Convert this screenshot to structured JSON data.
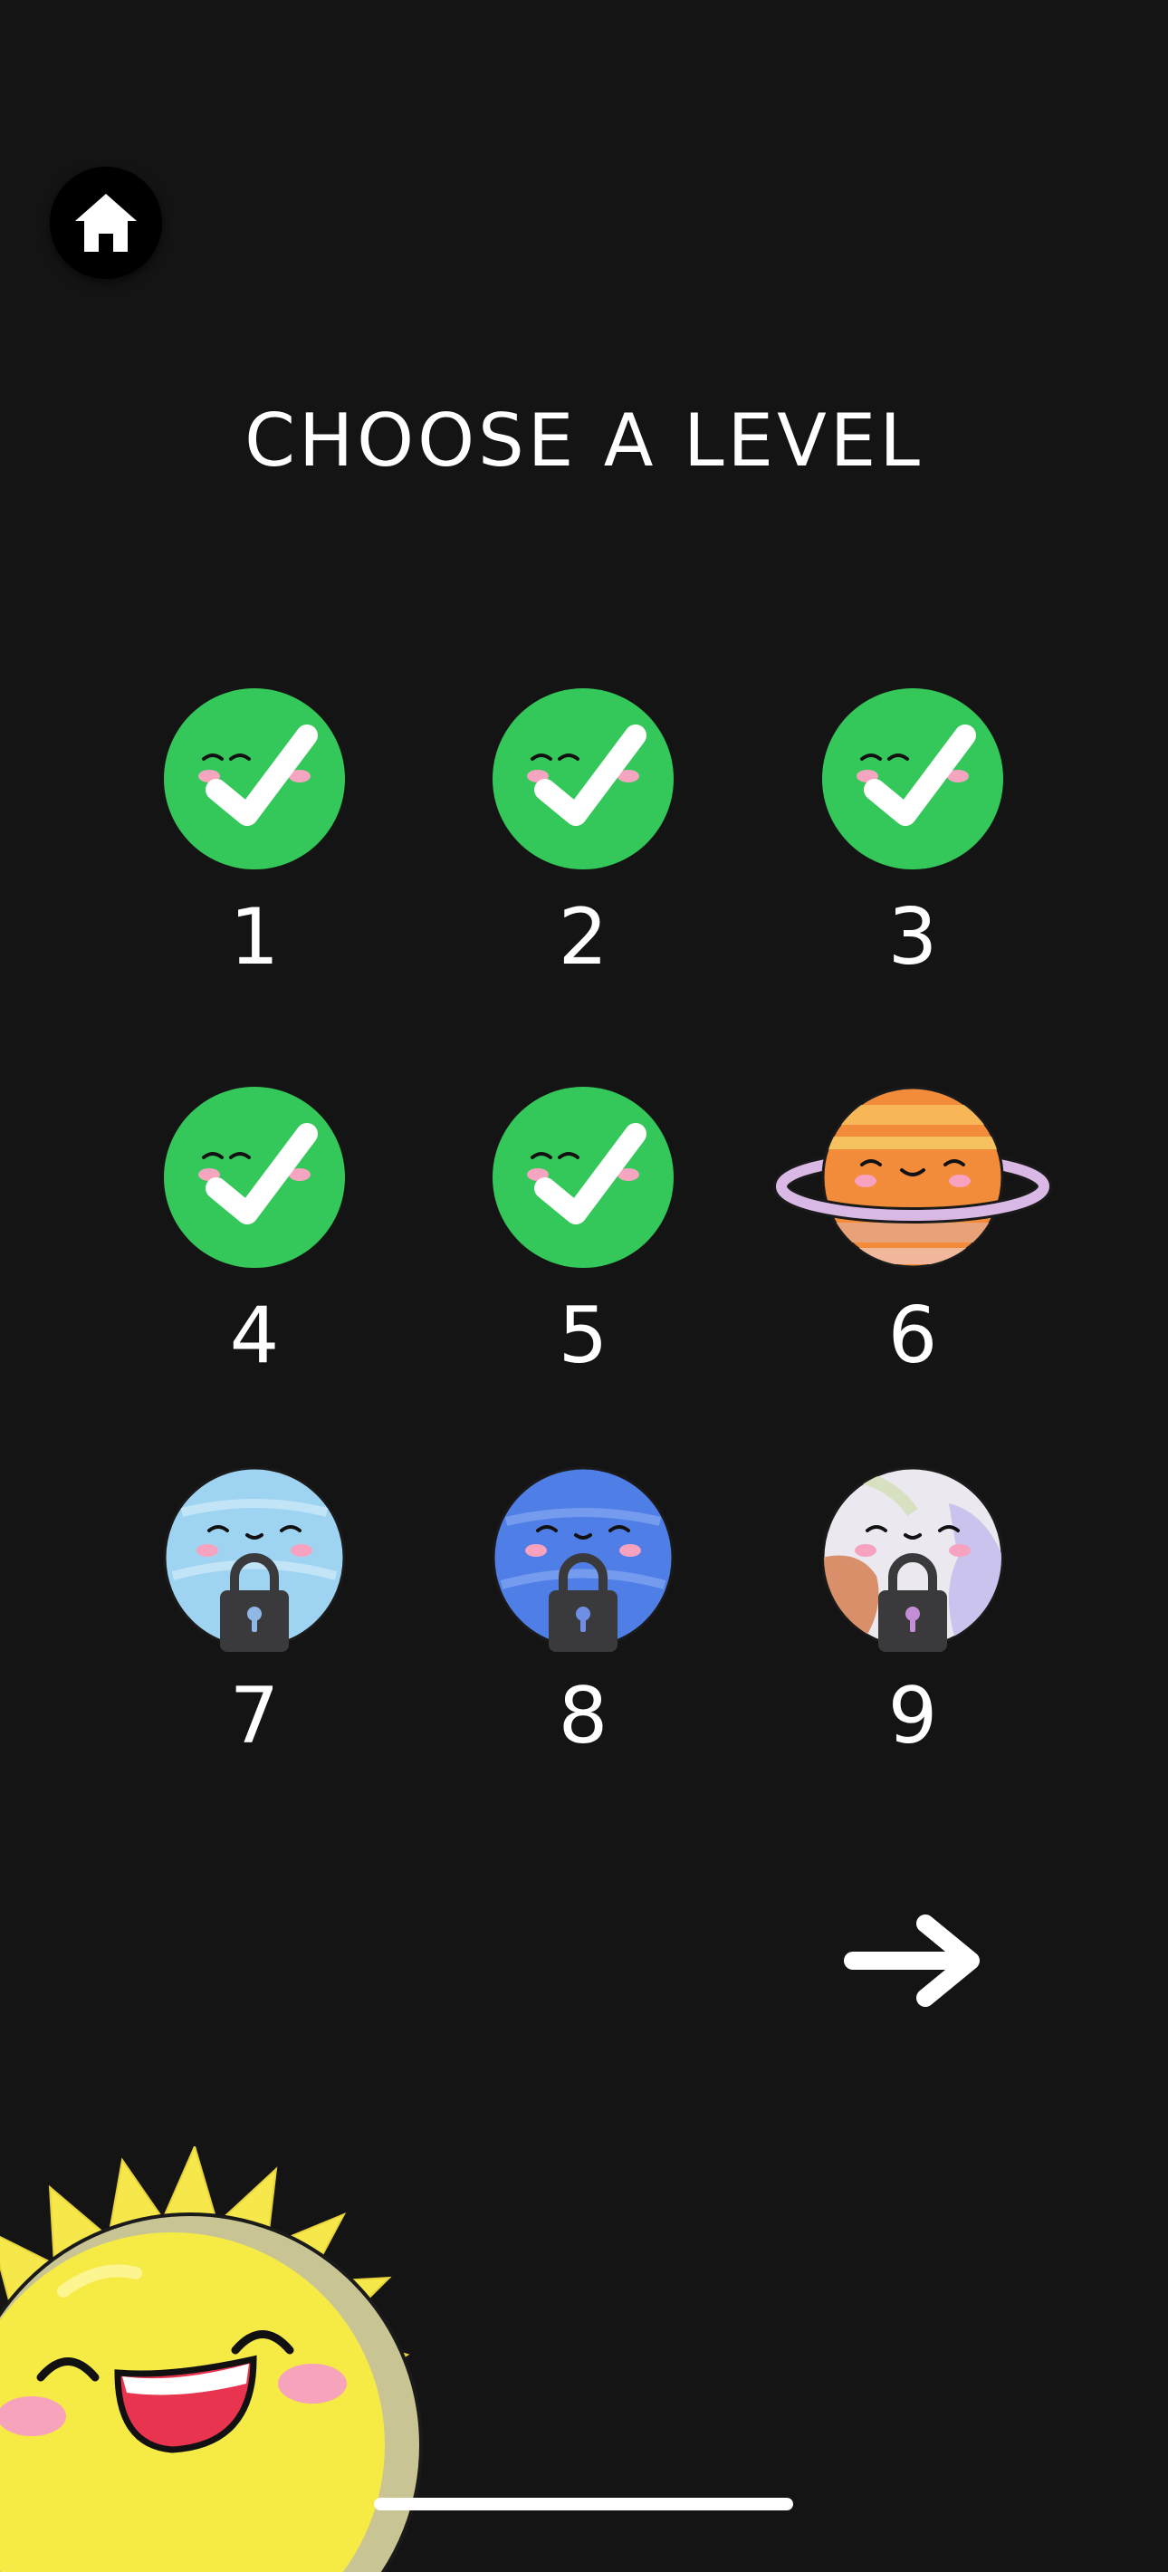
{
  "screen": {
    "title": "CHOOSE A LEVEL"
  },
  "home_button": {
    "icon": "home-icon"
  },
  "next_button": {
    "icon": "arrow-right-icon"
  },
  "levels": [
    {
      "number": "1",
      "status": "completed",
      "icon": "check-face-icon"
    },
    {
      "number": "2",
      "status": "completed",
      "icon": "check-face-icon"
    },
    {
      "number": "3",
      "status": "completed",
      "icon": "check-face-icon"
    },
    {
      "number": "4",
      "status": "completed",
      "icon": "check-face-icon"
    },
    {
      "number": "5",
      "status": "completed",
      "icon": "check-face-icon"
    },
    {
      "number": "6",
      "status": "current",
      "icon": "ringed-planet-icon"
    },
    {
      "number": "7",
      "status": "locked",
      "icon": "light-blue-planet-icon"
    },
    {
      "number": "8",
      "status": "locked",
      "icon": "blue-planet-icon"
    },
    {
      "number": "9",
      "status": "locked",
      "icon": "pale-planet-icon"
    }
  ],
  "colors": {
    "background": "#141414",
    "completed_green": "#34c759",
    "text": "#ffffff",
    "lock": "#3a3a3c",
    "sun_yellow": "#f6e84a"
  }
}
